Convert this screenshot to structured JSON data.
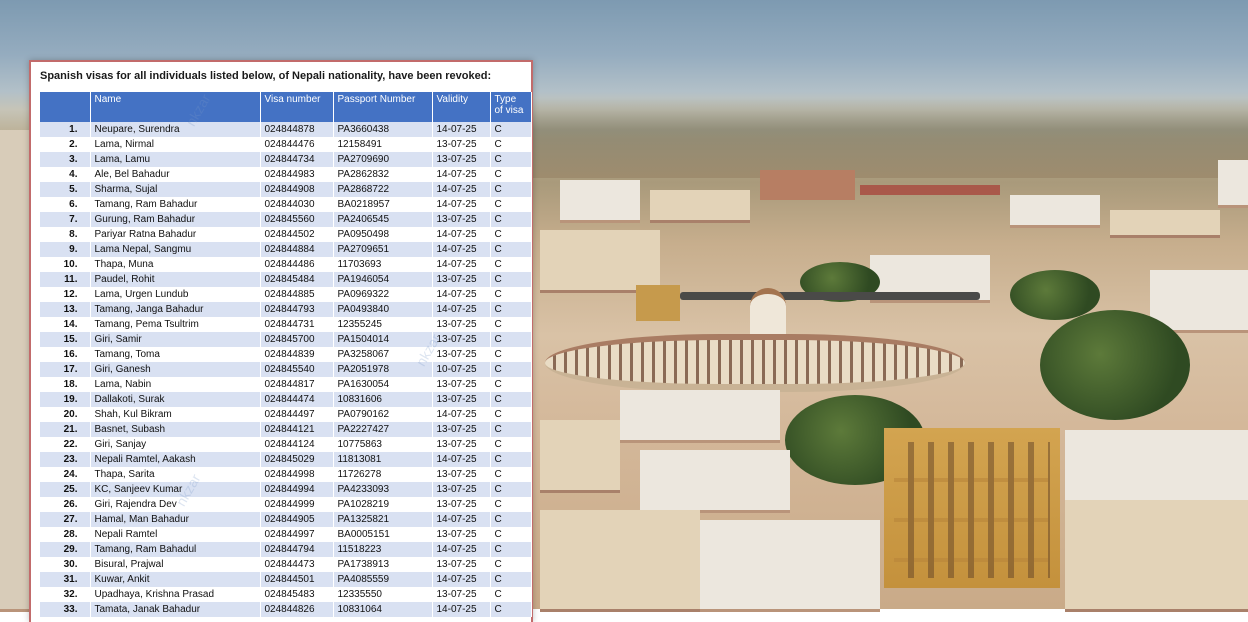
{
  "document": {
    "title": "Spanish visas for all individuals listed below, of Nepali nationality, have been revoked:",
    "columns": [
      "",
      "Name",
      "Visa number",
      "Passport Number",
      "Validity",
      "Type of visa"
    ],
    "rows": [
      {
        "no": "1.",
        "name": "Neupare, Surendra",
        "visa": "024844878",
        "passport": "PA3660438",
        "validity": "14-07-25",
        "type": "C"
      },
      {
        "no": "2.",
        "name": "Lama, Nirmal",
        "visa": "024844476",
        "passport": "12158491",
        "validity": "13-07-25",
        "type": "C"
      },
      {
        "no": "3.",
        "name": "Lama, Lamu",
        "visa": "024844734",
        "passport": "PA2709690",
        "validity": "13-07-25",
        "type": "C"
      },
      {
        "no": "4.",
        "name": "Ale, Bel Bahadur",
        "visa": "024844983",
        "passport": "PA2862832",
        "validity": "14-07-25",
        "type": "C"
      },
      {
        "no": "5.",
        "name": "Sharma, Sujal",
        "visa": "024844908",
        "passport": "PA2868722",
        "validity": "14-07-25",
        "type": "C"
      },
      {
        "no": "6.",
        "name": "Tamang, Ram Bahadur",
        "visa": "024844030",
        "passport": "BA0218957",
        "validity": "14-07-25",
        "type": "C"
      },
      {
        "no": "7.",
        "name": "Gurung, Ram Bahadur",
        "visa": "024845560",
        "passport": "PA2406545",
        "validity": "13-07-25",
        "type": "C"
      },
      {
        "no": "8.",
        "name": "Pariyar Ratna Bahadur",
        "visa": "024844502",
        "passport": "PA0950498",
        "validity": "14-07-25",
        "type": "C"
      },
      {
        "no": "9.",
        "name": "Lama Nepal, Sangmu",
        "visa": "024844884",
        "passport": "PA2709651",
        "validity": "14-07-25",
        "type": "C"
      },
      {
        "no": "10.",
        "name": "Thapa, Muna",
        "visa": "024844486",
        "passport": "11703693",
        "validity": "14-07-25",
        "type": "C"
      },
      {
        "no": "11.",
        "name": "Paudel, Rohit",
        "visa": "024845484",
        "passport": "PA1946054",
        "validity": "13-07-25",
        "type": "C"
      },
      {
        "no": "12.",
        "name": "Lama, Urgen Lundub",
        "visa": "024844885",
        "passport": "PA0969322",
        "validity": "14-07-25",
        "type": "C"
      },
      {
        "no": "13.",
        "name": "Tamang, Janga Bahadur",
        "visa": "024844793",
        "passport": "PA0493840",
        "validity": "14-07-25",
        "type": "C"
      },
      {
        "no": "14.",
        "name": "Tamang, Pema Tsultrim",
        "visa": "024844731",
        "passport": "12355245",
        "validity": "13-07-25",
        "type": "C"
      },
      {
        "no": "15.",
        "name": "Giri, Samir",
        "visa": "024845700",
        "passport": "PA1504014",
        "validity": "13-07-25",
        "type": "C"
      },
      {
        "no": "16.",
        "name": "Tamang, Toma",
        "visa": "024844839",
        "passport": "PA3258067",
        "validity": "13-07-25",
        "type": "C"
      },
      {
        "no": "17.",
        "name": "Giri, Ganesh",
        "visa": "024845540",
        "passport": "PA2051978",
        "validity": "10-07-25",
        "type": "C"
      },
      {
        "no": "18.",
        "name": "Lama, Nabin",
        "visa": "024844817",
        "passport": "PA1630054",
        "validity": "13-07-25",
        "type": "C"
      },
      {
        "no": "19.",
        "name": "Dallakoti, Surak",
        "visa": "024844474",
        "passport": "10831606",
        "validity": "13-07-25",
        "type": "C"
      },
      {
        "no": "20.",
        "name": "Shah, Kul Bikram",
        "visa": "024844497",
        "passport": "PA0790162",
        "validity": "14-07-25",
        "type": "C"
      },
      {
        "no": "21.",
        "name": "Basnet, Subash",
        "visa": "024844121",
        "passport": "PA2227427",
        "validity": "13-07-25",
        "type": "C"
      },
      {
        "no": "22.",
        "name": "Giri, Sanjay",
        "visa": "024844124",
        "passport": "10775863",
        "validity": "13-07-25",
        "type": "C"
      },
      {
        "no": "23.",
        "name": "Nepali Ramtel, Aakash",
        "visa": "024845029",
        "passport": "11813081",
        "validity": "14-07-25",
        "type": "C"
      },
      {
        "no": "24.",
        "name": "Thapa, Sarita",
        "visa": "024844998",
        "passport": "11726278",
        "validity": "13-07-25",
        "type": "C"
      },
      {
        "no": "25.",
        "name": "KC, Sanjeev Kumar",
        "visa": "024844994",
        "passport": "PA4233093",
        "validity": "13-07-25",
        "type": "C"
      },
      {
        "no": "26.",
        "name": "Giri, Rajendra Dev",
        "visa": "024844999",
        "passport": "PA1028219",
        "validity": "13-07-25",
        "type": "C"
      },
      {
        "no": "27.",
        "name": "Hamal, Man Bahadur",
        "visa": "024844905",
        "passport": "PA1325821",
        "validity": "14-07-25",
        "type": "C"
      },
      {
        "no": "28.",
        "name": "Nepali Ramtel",
        "visa": "024844997",
        "passport": "BA0005151",
        "validity": "13-07-25",
        "type": "C"
      },
      {
        "no": "29.",
        "name": "Tamang, Ram Bahadul",
        "visa": "024844794",
        "passport": "11518223",
        "validity": "14-07-25",
        "type": "C"
      },
      {
        "no": "30.",
        "name": "Bisural, Prajwal",
        "visa": "024844473",
        "passport": "PA1738913",
        "validity": "13-07-25",
        "type": "C"
      },
      {
        "no": "31.",
        "name": "Kuwar, Ankit",
        "visa": "024844501",
        "passport": "PA4085559",
        "validity": "14-07-25",
        "type": "C"
      },
      {
        "no": "32.",
        "name": "Upadhaya, Krishna Prasad",
        "visa": "024845483",
        "passport": "12335550",
        "validity": "13-07-25",
        "type": "C"
      },
      {
        "no": "33.",
        "name": "Tamata, Janak Bahadur",
        "visa": "024844826",
        "passport": "10831064",
        "validity": "14-07-25",
        "type": "C"
      }
    ]
  },
  "colors": {
    "header_blue": "#4472c4",
    "row_stripe": "#d9e1f2",
    "doc_border": "#c26b6b"
  }
}
